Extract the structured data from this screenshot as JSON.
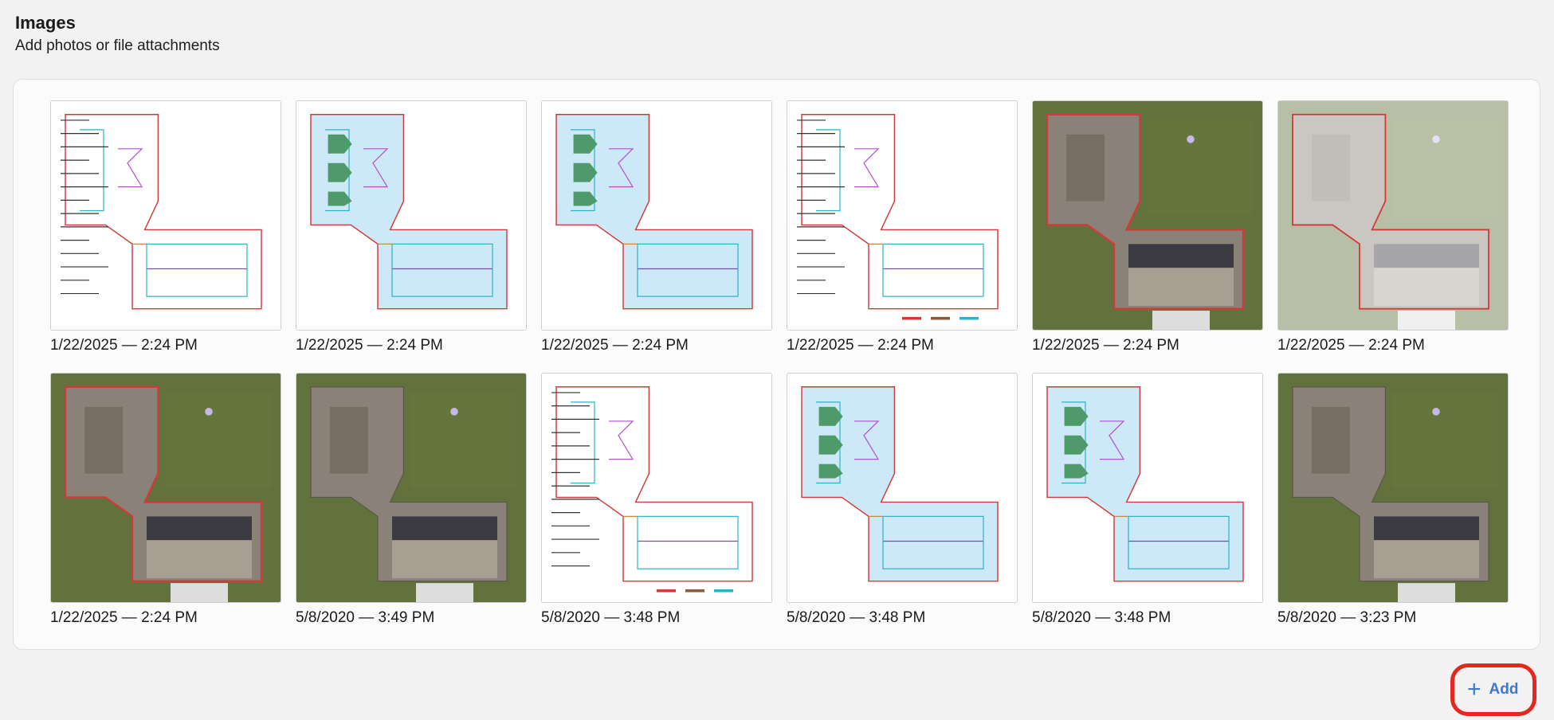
{
  "header": {
    "title": "Images",
    "subtitle": "Add photos or file attachments"
  },
  "images": [
    {
      "caption": "1/22/2025 — 2:24 PM",
      "kind": "line-diagram"
    },
    {
      "caption": "1/22/2025 — 2:24 PM",
      "kind": "pitch-diagram"
    },
    {
      "caption": "1/22/2025 — 2:24 PM",
      "kind": "area-diagram"
    },
    {
      "caption": "1/22/2025 — 2:24 PM",
      "kind": "length-diagram"
    },
    {
      "caption": "1/22/2025 — 2:24 PM",
      "kind": "aerial-outlined"
    },
    {
      "caption": "1/22/2025 — 2:24 PM",
      "kind": "aerial-faded"
    },
    {
      "caption": "1/22/2025 — 2:24 PM",
      "kind": "aerial-outlined"
    },
    {
      "caption": "5/8/2020 — 3:49 PM",
      "kind": "aerial-photo"
    },
    {
      "caption": "5/8/2020 — 3:48 PM",
      "kind": "length-diagram"
    },
    {
      "caption": "5/8/2020 — 3:48 PM",
      "kind": "area-diagram"
    },
    {
      "caption": "5/8/2020 — 3:48 PM",
      "kind": "pitch-diagram"
    },
    {
      "caption": "5/8/2020 — 3:23 PM",
      "kind": "aerial-photo"
    }
  ],
  "add_button": {
    "icon": "plus-icon",
    "label": "Add"
  },
  "colors": {
    "accent": "#3f79c8",
    "highlight": "#e5281e",
    "roof_fill": "#cde8f7",
    "outline": "#d23a3a",
    "grass": "#5b6e3a"
  }
}
